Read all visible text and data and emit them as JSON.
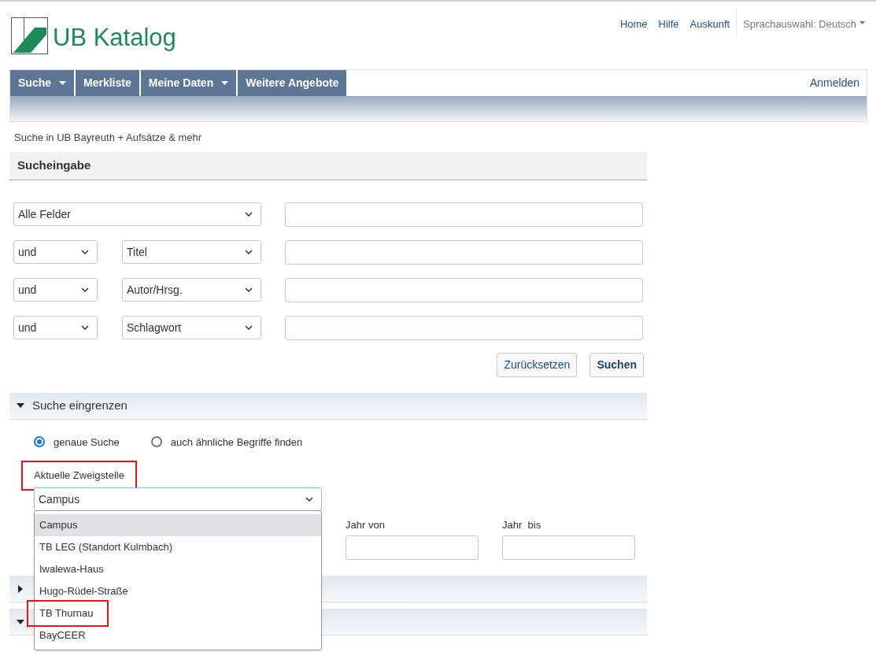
{
  "header": {
    "title": "UB Katalog",
    "links": [
      "Home",
      "Hilfe",
      "Auskunft"
    ],
    "language": "Sprachauswahl: Deutsch"
  },
  "nav": {
    "items": [
      {
        "label": "Suche",
        "has_menu": true
      },
      {
        "label": "Merkliste",
        "has_menu": false
      },
      {
        "label": "Meine Daten",
        "has_menu": true
      },
      {
        "label": "Weitere Angebote",
        "has_menu": false
      }
    ],
    "login": "Anmelden"
  },
  "breadcrumb": "Suche in UB Bayreuth + Aufsätze & mehr",
  "search": {
    "title": "Sucheingabe",
    "rows": [
      {
        "field": "Alle Felder"
      },
      {
        "operator": "und",
        "field": "Titel"
      },
      {
        "operator": "und",
        "field": "Autor/Hrsg."
      },
      {
        "operator": "und",
        "field": "Schlagwort"
      }
    ],
    "buttons": [
      {
        "label": "Zurücksetzen",
        "kind": "secondary"
      },
      {
        "label": "Suchen",
        "kind": "primary"
      }
    ]
  },
  "refine": {
    "title": "Suche eingrenzen",
    "expanded": true,
    "radios": [
      {
        "label": "genaue Suche",
        "selected": true
      },
      {
        "label": "auch ähnliche Begriffe finden",
        "selected": false
      }
    ],
    "branch": {
      "label": "Aktuelle Zweigstelle",
      "highlighted": true,
      "value": "Campus",
      "open": true,
      "options": [
        {
          "label": "Campus",
          "selected": true,
          "highlighted": false
        },
        {
          "label": "TB LEG (Standort Kulmbach)",
          "selected": false,
          "highlighted": false
        },
        {
          "label": "Iwalewa-Haus",
          "selected": false,
          "highlighted": false
        },
        {
          "label": "Hugo-Rüdel-Straße",
          "selected": false,
          "highlighted": false
        },
        {
          "label": "TB Thurnau",
          "selected": false,
          "highlighted": true
        },
        {
          "label": "BayCEER",
          "selected": false,
          "highlighted": false
        }
      ]
    },
    "years": [
      "Jahr von",
      "Jahr  bis"
    ]
  },
  "sections": [
    {
      "expanded": false
    },
    {
      "expanded": true
    }
  ]
}
